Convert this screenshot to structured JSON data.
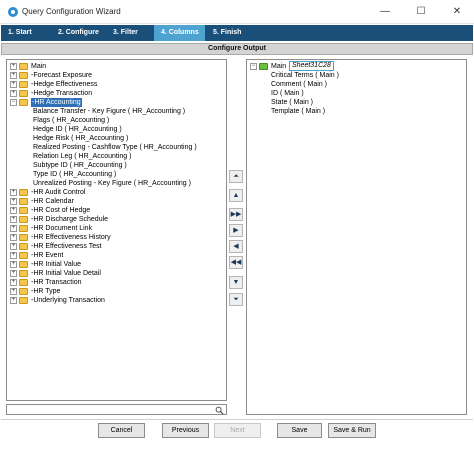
{
  "window": {
    "title": "Query Configuration Wizard",
    "minimize_glyph": "—",
    "maximize_glyph": "☐",
    "close_glyph": "✕"
  },
  "tabs": [
    {
      "label": "1. Start",
      "active": false
    },
    {
      "label": "2. Configure",
      "active": false
    },
    {
      "label": "3. Filter",
      "active": false
    },
    {
      "label": "4. Columns",
      "active": true
    },
    {
      "label": "5. Finish",
      "active": false
    }
  ],
  "section_title": "Configure Output",
  "left_tree": {
    "root": "Main",
    "items": [
      "-Forecast Exposure",
      "-Hedge Effectiveness",
      "-Hedge Transaction",
      "-HR Accounting"
    ],
    "hr_accounting_children": [
      "Balance Transfer - Key Figure ( HR_Accounting )",
      "Flags ( HR_Accounting )",
      "Hedge ID ( HR_Accounting )",
      "Hedge Risk ( HR_Accounting )",
      "Realized Posting - Cashflow Type ( HR_Accounting )",
      "Relation Leg ( HR_Accounting )",
      "Subtype ID ( HR_Accounting )",
      "Type ID ( HR_Accounting )",
      "Unrealized Posting - Key Figure ( HR_Accounting )"
    ],
    "after_items": [
      "-HR Audit Control",
      "-HR Calendar",
      "-HR Cost of Hedge",
      "-HR Discharge Schedule",
      "-HR Document Link",
      "-HR Effectiveness History",
      "-HR Effectiveness Test",
      "-HR Event",
      "-HR Initial Value",
      "-HR Initial Value Detail",
      "-HR Transaction",
      "-HR Type",
      "-Underlying Transaction"
    ]
  },
  "right_tree": {
    "root": "Main",
    "tag": "Sheet31C28",
    "children": [
      "Critical Terms ( Main )",
      "Comment ( Main )",
      "ID ( Main )",
      "State ( Main )",
      "Template ( Main )"
    ]
  },
  "move_buttons": {
    "top": "⏶",
    "up": "▲",
    "add_all": "▶▶",
    "add": "▶",
    "remove": "◀",
    "remove_all": "◀◀",
    "down": "▼",
    "bottom": "⏷"
  },
  "search": {
    "value": "",
    "placeholder": ""
  },
  "buttons": {
    "cancel": "Cancel",
    "previous": "Previous",
    "next": "Next",
    "save": "Save",
    "save_run": "Save & Run"
  },
  "colors": {
    "tabbar": "#1a4f7a",
    "active_tab": "#4fa3d1",
    "selection": "#2f6fb6",
    "folder": "#f3c74b",
    "root_folder": "#6bbf45"
  }
}
